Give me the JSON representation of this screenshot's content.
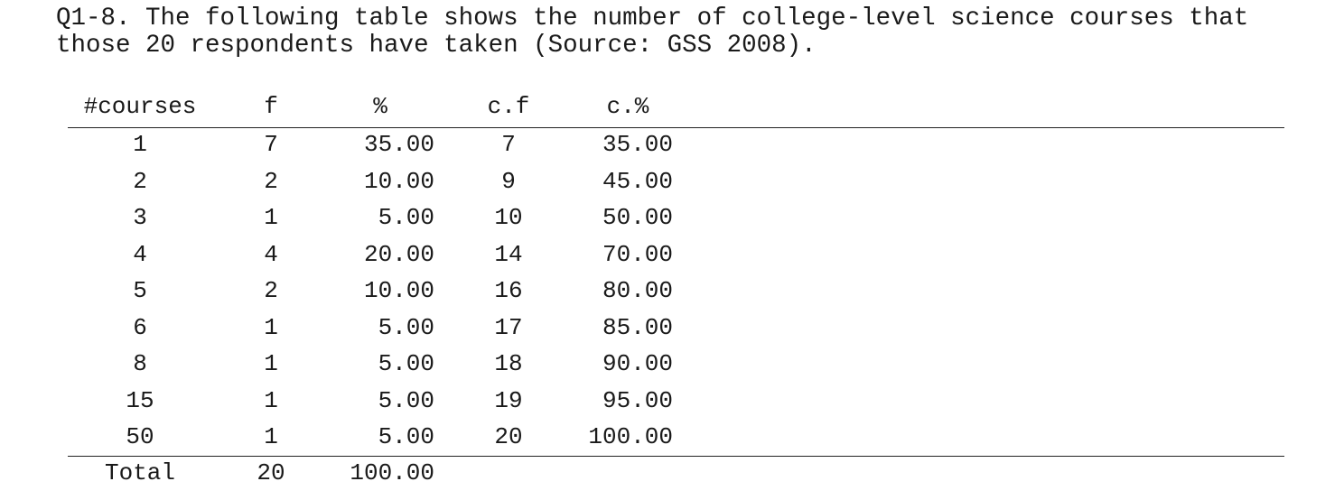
{
  "question": {
    "line1": "Q1-8. The following table shows the number of college-level science courses that",
    "line2": "those 20 respondents have taken (Source: GSS 2008)."
  },
  "table": {
    "headers": [
      "#courses",
      "f",
      "%",
      "c.f",
      "c.%"
    ],
    "rows": [
      [
        "1",
        "7",
        "35.00",
        "7",
        "35.00"
      ],
      [
        "2",
        "2",
        "10.00",
        "9",
        "45.00"
      ],
      [
        "3",
        "1",
        "5.00",
        "10",
        "50.00"
      ],
      [
        "4",
        "4",
        "20.00",
        "14",
        "70.00"
      ],
      [
        "5",
        "2",
        "10.00",
        "16",
        "80.00"
      ],
      [
        "6",
        "1",
        "5.00",
        "17",
        "85.00"
      ],
      [
        "8",
        "1",
        "5.00",
        "18",
        "90.00"
      ],
      [
        "15",
        "1",
        "5.00",
        "19",
        "95.00"
      ],
      [
        "50",
        "1",
        "5.00",
        "20",
        "100.00"
      ]
    ],
    "total": [
      "Total",
      "20",
      "100.00"
    ]
  }
}
